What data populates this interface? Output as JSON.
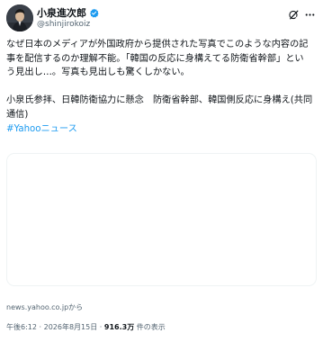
{
  "author": {
    "name": "小泉進次郎",
    "handle": "@shinjirokoiz",
    "verified": true
  },
  "header_icons": [
    "grok-icon",
    "more-icon"
  ],
  "post": {
    "line1": "なぜ日本のメディアが外国政府から提供された写真でこのような内容の記",
    "line2": "事を配信するのか理解不能。「韓国の反応に身構えてる防衛省幹部」とい",
    "line3": "う見出し…。写真も見出しも驚くしかない。",
    "line4": "小泉氏参拝、日韓防衛協力に懸念　防衛省幹部、韓国側反応に身構え(共同",
    "line5": "通信)",
    "hashtag": "#Yahooニュース"
  },
  "link_card": {
    "source": "news.yahoo.co.jpから"
  },
  "meta": {
    "time": "午後6:12",
    "separator": "·",
    "date": "2026年8月15日",
    "views_count": "916.3万",
    "views_label": "件の表示"
  },
  "colors": {
    "text": "#0f1419",
    "secondary": "#536471",
    "link": "#1d9bf0",
    "verified": "#1d9bf0",
    "card_border": "#eff3f4"
  }
}
